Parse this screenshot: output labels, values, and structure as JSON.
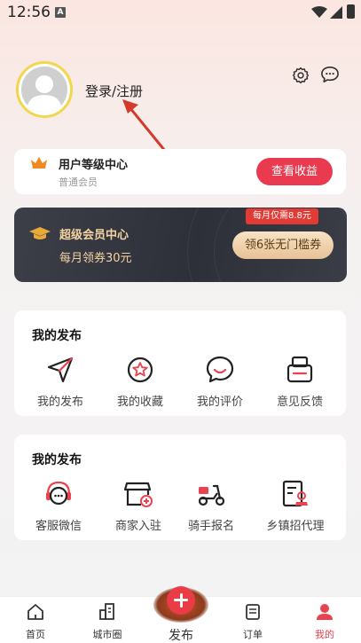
{
  "status_bar": {
    "time": "12:56",
    "notification_icon": "A"
  },
  "header": {
    "login_text": "登录/注册",
    "settings_icon": "gear-icon",
    "message_icon": "chat-bubble-icon"
  },
  "level_card": {
    "title": "用户等级中心",
    "subtitle": "普通会员",
    "button": "查看收益"
  },
  "vip_card": {
    "title": "超级会员中心",
    "subtitle": "每月领券30元",
    "tag": "每月仅需8.8元",
    "button": "领6张无门槛券"
  },
  "section1": {
    "title": "我的发布",
    "items": [
      {
        "label": "我的发布",
        "icon": "paper-plane-icon"
      },
      {
        "label": "我的收藏",
        "icon": "star-circle-icon"
      },
      {
        "label": "我的评价",
        "icon": "smile-bubble-icon"
      },
      {
        "label": "意见反馈",
        "icon": "feedback-tray-icon"
      }
    ]
  },
  "section2": {
    "title": "我的发布",
    "items": [
      {
        "label": "客服微信",
        "icon": "headset-chat-icon"
      },
      {
        "label": "商家入驻",
        "icon": "store-add-icon"
      },
      {
        "label": "骑手报名",
        "icon": "scooter-icon"
      },
      {
        "label": "乡镇招代理",
        "icon": "agent-badge-icon"
      }
    ]
  },
  "tabbar": {
    "tabs": [
      {
        "label": "首页",
        "icon": "home-icon"
      },
      {
        "label": "城市圈",
        "icon": "city-icon"
      },
      {
        "label": "发布",
        "icon": "plus-icon"
      },
      {
        "label": "订单",
        "icon": "order-list-icon"
      },
      {
        "label": "我的",
        "icon": "user-icon"
      }
    ],
    "active": "我的"
  },
  "colors": {
    "accent": "#ea3a4f",
    "gold": "#f4d3a2",
    "avatar_ring": "#f2d64b"
  }
}
